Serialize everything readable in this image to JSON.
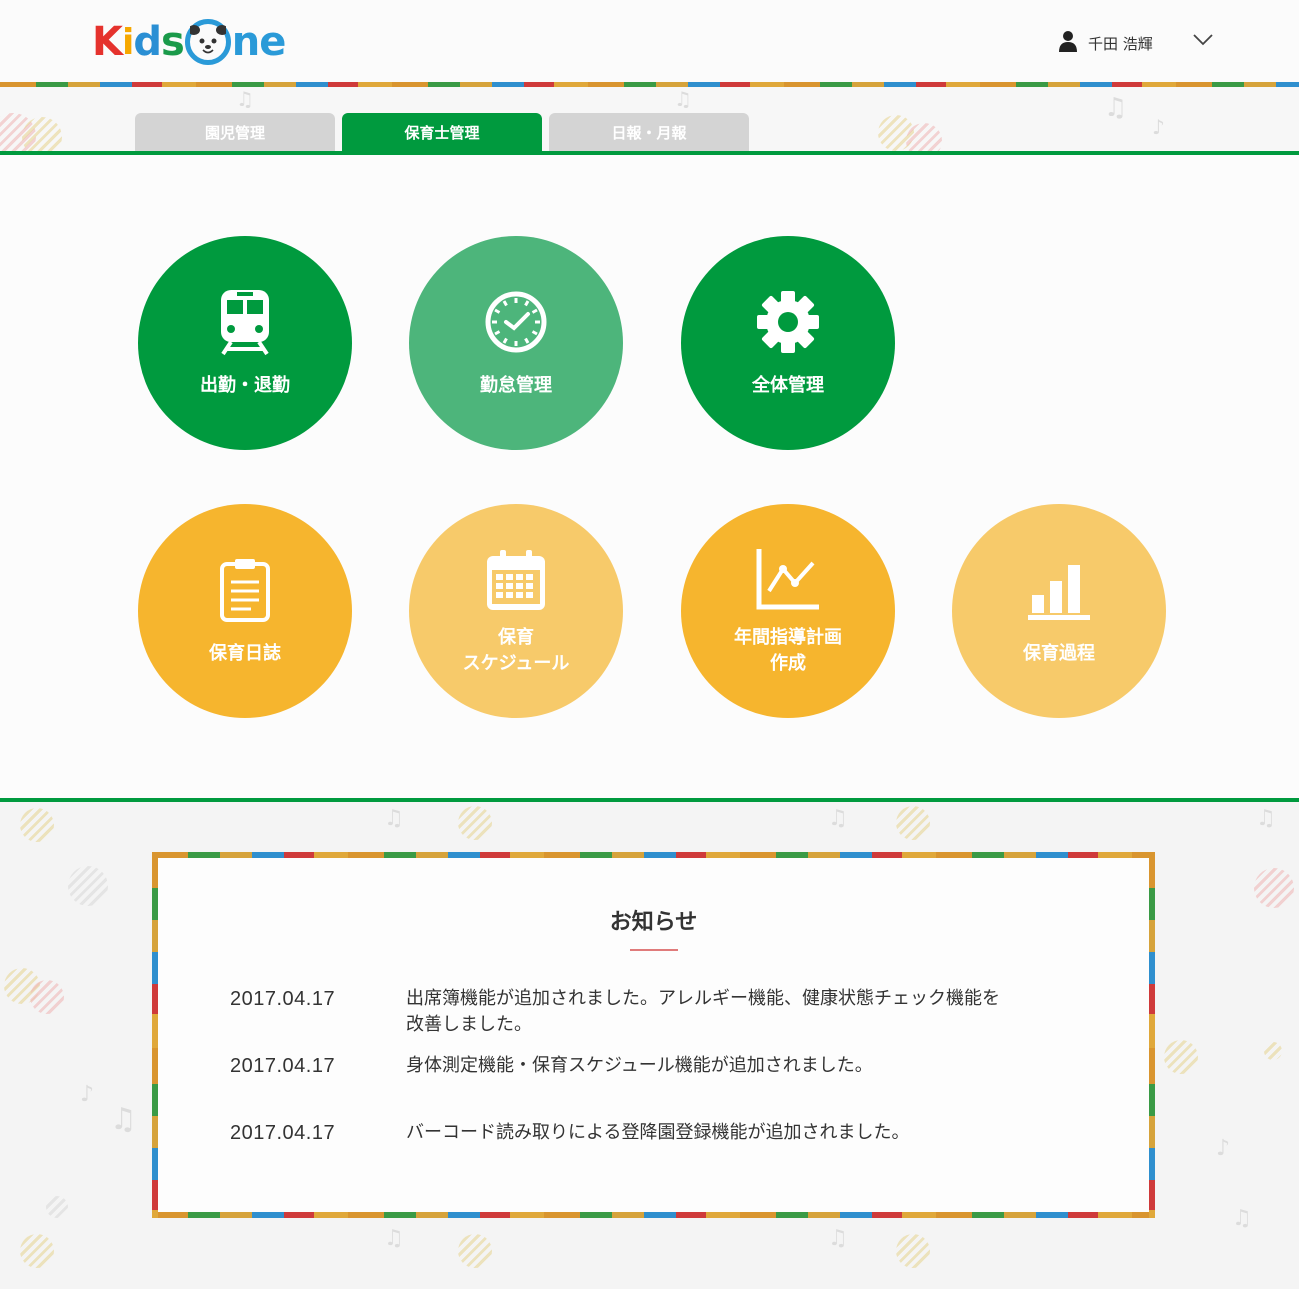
{
  "header": {
    "logo_letters": [
      "K",
      "i",
      "d",
      "s",
      "O",
      "n",
      "e"
    ],
    "user_name": "千田 浩輝"
  },
  "tabs": [
    {
      "label": "園児管理",
      "active": false
    },
    {
      "label": "保育士管理",
      "active": true
    },
    {
      "label": "日報・月報",
      "active": false
    }
  ],
  "menu": {
    "row1": [
      {
        "label": "出勤・退勤",
        "icon": "train-icon",
        "color": "#009a3e"
      },
      {
        "label": "勤怠管理",
        "icon": "clock-icon",
        "color": "#4db57b"
      },
      {
        "label": "全体管理",
        "icon": "gear-icon",
        "color": "#009a3e"
      }
    ],
    "row2": [
      {
        "label": "保育日誌",
        "icon": "clipboard-icon",
        "color": "#f6b52e"
      },
      {
        "label_line1": "保育",
        "label_line2": "スケジュール",
        "icon": "calendar-icon",
        "color": "#f7ca6a"
      },
      {
        "label_line1": "年間指導計画",
        "label_line2": "作成",
        "icon": "line-chart-icon",
        "color": "#f6b52e"
      },
      {
        "label": "保育過程",
        "icon": "bar-chart-icon",
        "color": "#f7ca6a"
      }
    ]
  },
  "notice": {
    "title": "お知らせ",
    "items": [
      {
        "date": "2017.04.17",
        "text_line1": "出席簿機能が追加されました。アレルギー機能、健康状態チェック機能を",
        "text_line2": "改善しました。"
      },
      {
        "date": "2017.04.17",
        "text_line1": "身体測定機能・保育スケジュール機能が追加されました。"
      },
      {
        "date": "2017.04.17",
        "text_line1": "バーコード読み取りによる登降園登録機能が追加されました。"
      }
    ]
  },
  "colors": {
    "brand_green": "#009a3e",
    "light_green": "#4db57b",
    "orange": "#f6b52e",
    "light_orange": "#f7ca6a"
  }
}
